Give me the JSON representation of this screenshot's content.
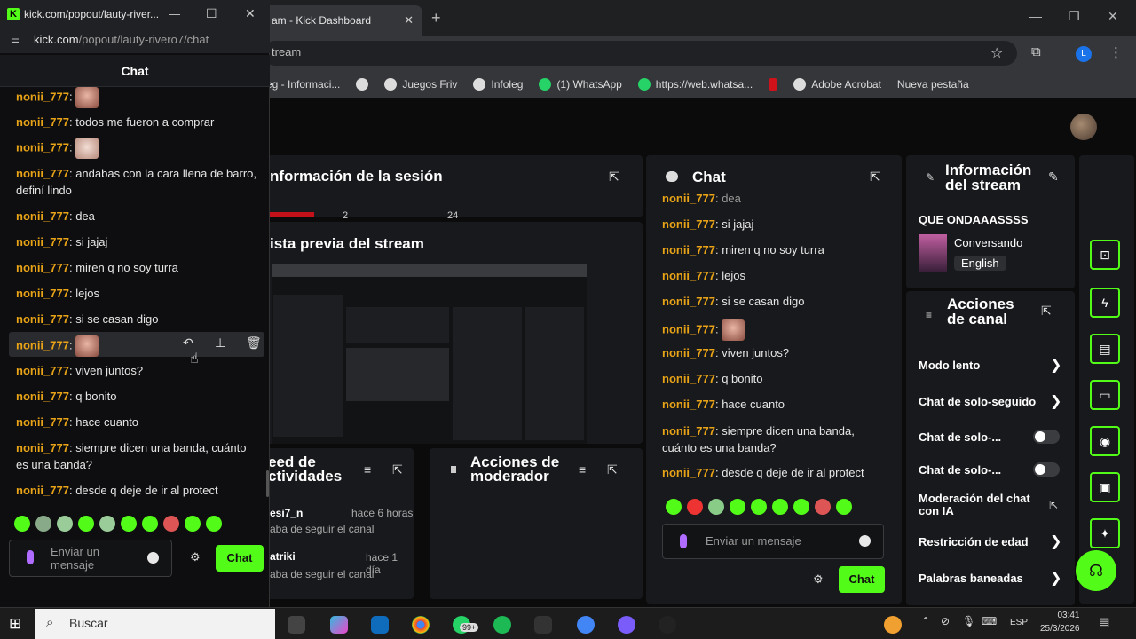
{
  "browser": {
    "tab_title": "am - Kick Dashboard",
    "url": "tream",
    "bookmarks": [
      "eg - Informaci...",
      "",
      "Juegos Friv",
      "Infoleg",
      "(1) WhatsApp",
      "https://web.whatsa...",
      "",
      "Adobe Acrobat",
      "Nueva pestaña"
    ]
  },
  "session": {
    "title": "nformación de la sesión",
    "nums": [
      "2",
      "24"
    ]
  },
  "preview": {
    "title": "ista previa del stream"
  },
  "feed": {
    "title": "eed de\nctividades",
    "rows": [
      {
        "user": "esi7_n",
        "time": "hace 6 horas",
        "text": "aba de seguir el canal"
      },
      {
        "user": "atriki",
        "time": "hace 1 día",
        "text": "aba de seguir el canal"
      }
    ]
  },
  "modactions": {
    "title": "Acciones de moderador"
  },
  "mid_chat": {
    "title": "Chat",
    "messages": [
      {
        "user": "nonii_777",
        "text": "dea"
      },
      {
        "user": "nonii_777",
        "text": "si jajaj"
      },
      {
        "user": "nonii_777",
        "text": "miren q no soy turra"
      },
      {
        "user": "nonii_777",
        "text": "lejos"
      },
      {
        "user": "nonii_777",
        "text": "si se casan digo"
      },
      {
        "user": "nonii_777",
        "text": ""
      },
      {
        "user": "nonii_777",
        "text": "viven juntos?"
      },
      {
        "user": "nonii_777",
        "text": "q bonito"
      },
      {
        "user": "nonii_777",
        "text": "hace cuanto"
      },
      {
        "user": "nonii_777",
        "text": "siempre dicen una banda, cuánto es una banda?"
      },
      {
        "user": "nonii_777",
        "text": "desde q deje de ir al protect"
      }
    ],
    "placeholder": "Enviar un mensaje",
    "send": "Chat"
  },
  "stream_info": {
    "title": "Información del stream",
    "stream_title": "QUE ONDAAASSSS",
    "category": "Conversando",
    "language": "English"
  },
  "channel_actions": {
    "title": "Acciones de canal",
    "items": [
      "Modo lento",
      "Chat de solo-seguido",
      "Chat de solo-...",
      "Chat de solo-...",
      "Moderación del chat con IA",
      "Restricción de edad",
      "Palabras baneadas"
    ]
  },
  "popout": {
    "window_title": "kick.com/popout/lauty-river...",
    "url_host": "kick.com",
    "url_path": "/popout/lauty-rivero7/chat",
    "chat_label": "Chat",
    "messages": [
      {
        "user": "nonii_777",
        "text": ""
      },
      {
        "user": "nonii_777",
        "text": "todos me fueron a comprar"
      },
      {
        "user": "nonii_777",
        "text": ""
      },
      {
        "user": "nonii_777",
        "text": "andabas con la cara llena de barro, definí lindo"
      },
      {
        "user": "nonii_777",
        "text": "dea"
      },
      {
        "user": "nonii_777",
        "text": "si jajaj"
      },
      {
        "user": "nonii_777",
        "text": "miren q no soy turra"
      },
      {
        "user": "nonii_777",
        "text": "lejos"
      },
      {
        "user": "nonii_777",
        "text": "si se casan digo"
      },
      {
        "user": "nonii_777",
        "text": ""
      },
      {
        "user": "nonii_777",
        "text": "viven juntos?"
      },
      {
        "user": "nonii_777",
        "text": "q bonito"
      },
      {
        "user": "nonii_777",
        "text": "hace cuanto"
      },
      {
        "user": "nonii_777",
        "text": "siempre dicen una banda, cuánto es una banda?"
      },
      {
        "user": "nonii_777",
        "text": "desde q deje de ir al protect"
      }
    ],
    "placeholder": "Enviar un mensaje",
    "send": "Chat"
  },
  "taskbar": {
    "search": "Buscar",
    "badge": "99+",
    "lang": "ESP",
    "time": "03:41",
    "date": "25/3/2026"
  },
  "colors": {
    "accent": "#53fc18",
    "username": "#e8a317",
    "panel": "#18191c"
  }
}
